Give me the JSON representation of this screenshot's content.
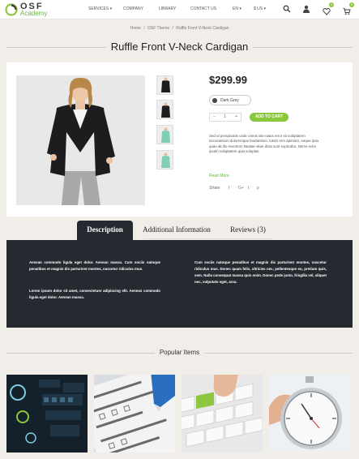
{
  "header": {
    "logo_osf": "OSF",
    "logo_academy": "Academy",
    "nav": [
      {
        "label": "SERVICES",
        "chevron": true
      },
      {
        "label": "COMPANY"
      },
      {
        "label": "LIBRARY"
      },
      {
        "label": "CONTACT US"
      }
    ],
    "lang": "EN",
    "currency": "$ US",
    "wishlist_count": "0",
    "cart_count": "0",
    "colors": {
      "accent": "#8dc63f",
      "dark": "#262a30"
    }
  },
  "breadcrumb": {
    "items": [
      "Home",
      "OSF Theme",
      "Ruffle Front V-Neck Cardigan"
    ],
    "separator": "/"
  },
  "product": {
    "title": "Ruffle Front V-Neck Cardigan",
    "price": "$299.99",
    "color_label": "Dark Grey",
    "qty_minus": "−",
    "qty_value": "1",
    "qty_plus": "+",
    "add_to_cart": "ADD TO CART",
    "description": "Sed ut perspiciatis unde omnis iste natus error sit voluptatem accusantium doloremque laudantium, totam rem aperiam, eaque ipsa quae ab illo inventore Beatae vitae dicta sunt explicabo. Nemo enim ipsam voluptatem quia voluptas",
    "read_more": "Read More",
    "share_label": "Share",
    "share_icons": [
      "f",
      "G+",
      "t",
      "p"
    ]
  },
  "tabs": {
    "items": [
      "Description",
      "Additional Information",
      "Reviews (3)"
    ],
    "active": 0,
    "col1_p1": "Aenean commodo ligula eget dolor. Aenean massa. Cum sociis natoque penatibus et magnis dis parturient montes, nascetur ridiculus mus.",
    "col1_p2": "Lorem ipsum dolor sit amet, consectetuer adipiscing elit. Aenean commodo ligula eget dolor. Aenean massa.",
    "col2_p1": "Cum sociis natoque penatibus et magnis dis parturient montes, nascetur ridiculus mus. Donec quam felis, ultricies nec, pellentesque eu, pretium quis, sem. Nulla consequat massa quis enim. Donec pede justo, fringilla vel, aliquet nec, vulputate eget, arcu."
  },
  "popular": {
    "title": "Popular Items",
    "tile_names": [
      "dashboard-ui",
      "survey-form",
      "keyboard-blog",
      "stopwatch"
    ]
  }
}
